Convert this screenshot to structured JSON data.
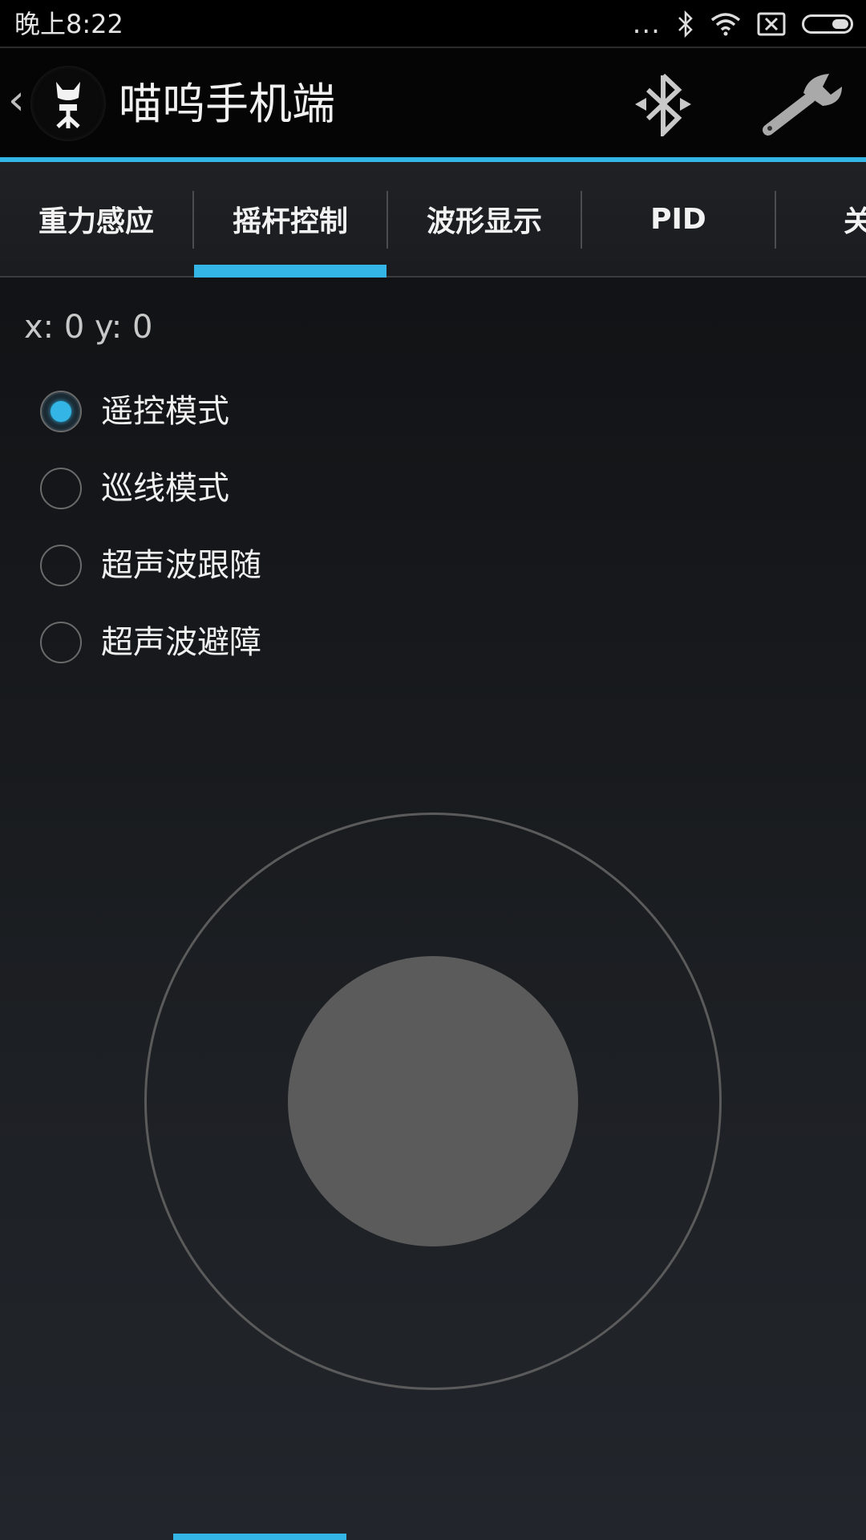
{
  "status_bar": {
    "time": "晚上8:22",
    "more": "...",
    "icons": [
      "bluetooth-icon",
      "wifi-icon",
      "no-sim-icon",
      "battery-icon"
    ]
  },
  "action_bar": {
    "title": "喵呜手机端",
    "logo_icon": "cat-logo-icon",
    "actions": [
      "bluetooth-icon",
      "wrench-icon"
    ]
  },
  "tabs": [
    {
      "label": "重力感应",
      "selected": false
    },
    {
      "label": "摇杆控制",
      "selected": true
    },
    {
      "label": "波形显示",
      "selected": false
    },
    {
      "label": "PID",
      "selected": false
    },
    {
      "label": "关",
      "selected": false
    }
  ],
  "coords_text": "x: 0 y: 0",
  "modes": [
    {
      "label": "遥控模式",
      "checked": true
    },
    {
      "label": "巡线模式",
      "checked": false
    },
    {
      "label": "超声波跟随",
      "checked": false
    },
    {
      "label": "超声波避障",
      "checked": false
    }
  ],
  "colors": {
    "accent": "#33b5e5",
    "joystick": "#5b5b5b"
  }
}
